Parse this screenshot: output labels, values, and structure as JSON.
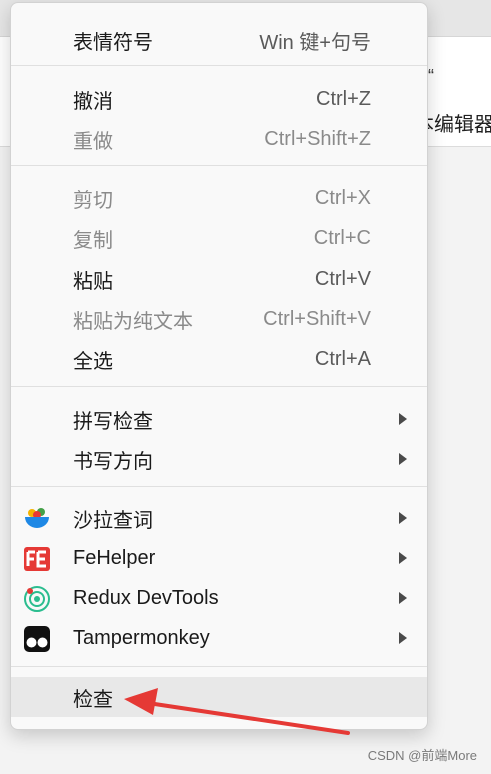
{
  "background": {
    "quote_glyph": "“",
    "text_fragment": "本编辑器"
  },
  "watermark": "CSDN @前端More",
  "menu": {
    "items": [
      {
        "label": "表情符号",
        "shortcut": "Win 键+句号"
      },
      {
        "label": "撤消",
        "shortcut": "Ctrl+Z"
      },
      {
        "label": "重做",
        "shortcut": "Ctrl+Shift+Z"
      },
      {
        "label": "剪切",
        "shortcut": "Ctrl+X"
      },
      {
        "label": "复制",
        "shortcut": "Ctrl+C"
      },
      {
        "label": "粘贴",
        "shortcut": "Ctrl+V"
      },
      {
        "label": "粘贴为纯文本",
        "shortcut": "Ctrl+Shift+V"
      },
      {
        "label": "全选",
        "shortcut": "Ctrl+A"
      },
      {
        "label": "拼写检查"
      },
      {
        "label": "书写方向"
      },
      {
        "label": "沙拉查词"
      },
      {
        "label": "FeHelper"
      },
      {
        "label": "Redux DevTools"
      },
      {
        "label": "Tampermonkey"
      },
      {
        "label": "检查"
      }
    ]
  },
  "colors": {
    "annotation_arrow": "#e53935",
    "fehelper_red": "#e53935",
    "redux_green": "#2bbd8f"
  }
}
